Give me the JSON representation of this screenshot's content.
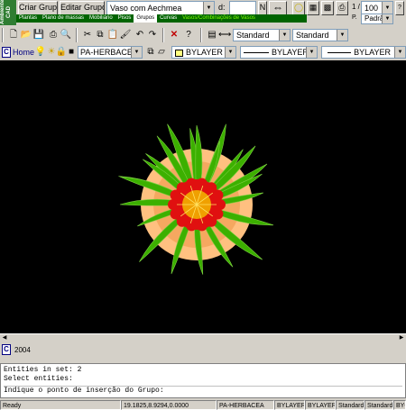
{
  "logo": {
    "text": "Ambiente CAD"
  },
  "toolbar1": {
    "criar_grupo": "Criar Grupo",
    "editar_grupos": "Editar Grupos",
    "group_select": "Vaso com Aechmea",
    "d_label": "d:",
    "d_value": "",
    "n_label": "N",
    "scale_label": "1 /",
    "scale_value": "100",
    "p_label": "P.",
    "padrao": "Padrão"
  },
  "tabs": [
    "Plantas",
    "Plano de massas",
    "Mobiliário",
    "Pisos",
    "Grupos",
    "Curvas",
    "Vasos/Combinações de Vasos"
  ],
  "toolbar2": {
    "text_style": "Standard",
    "dim_style": "Standard"
  },
  "layerbar": {
    "home": "Home",
    "layer": "PA-HERBACEA",
    "color": "BYLAYER",
    "linetype": "BYLAYER",
    "lineweight": "BYLAYER"
  },
  "model_tab": {
    "label": "2004"
  },
  "command": {
    "lines": [
      "Entities in set: 2",
      "Select entities:"
    ],
    "prompt": "Indique o ponto de inserção do Grupo:"
  },
  "status": {
    "ready": "Ready",
    "coords": "19.1825,8.9294,0.0000",
    "layer": "PA-HERBACEA",
    "color": "BYLAYER",
    "linetype": "BYLAYER",
    "textstyle": "Standard",
    "dimstyle": "Standard",
    "extra": "BYCO"
  },
  "colors": {
    "canvas": "#000000",
    "leaf": "#3cb000",
    "pot": "#ffc080",
    "flower": "#e01010",
    "center": "#f0a000"
  }
}
